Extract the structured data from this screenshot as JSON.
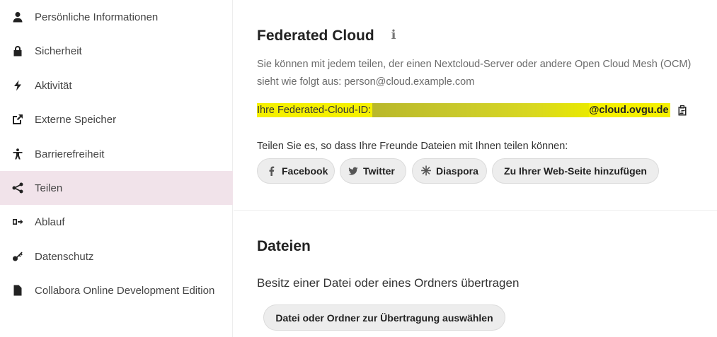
{
  "sidebar": {
    "items": [
      {
        "label": "Persönliche Informationen",
        "icon": "person-icon",
        "active": false
      },
      {
        "label": "Sicherheit",
        "icon": "lock-icon",
        "active": false
      },
      {
        "label": "Aktivität",
        "icon": "lightning-icon",
        "active": false
      },
      {
        "label": "Externe Speicher",
        "icon": "external-link-icon",
        "active": false
      },
      {
        "label": "Barrierefreiheit",
        "icon": "accessibility-icon",
        "active": false
      },
      {
        "label": "Teilen",
        "icon": "share-icon",
        "active": true
      },
      {
        "label": "Ablauf",
        "icon": "workflow-icon",
        "active": false
      },
      {
        "label": "Datenschutz",
        "icon": "key-icon",
        "active": false
      },
      {
        "label": "Collabora Online Development Edition",
        "icon": "document-icon",
        "active": false
      }
    ]
  },
  "federated": {
    "title": "Federated Cloud",
    "info_icon": "i",
    "desc_line1": "Sie können mit jedem teilen, der einen Nextcloud-Server oder andere Open Cloud Mesh (OCM)",
    "desc_line2": "sieht wie folgt aus: person@cloud.example.com",
    "cloud_id_label": "Ihre Federated-Cloud-ID:",
    "cloud_id_domain": "@cloud.ovgu.de",
    "share_text": "Teilen Sie es, so dass Ihre Freunde Dateien mit Ihnen teilen können:",
    "buttons": [
      {
        "label": "Facebook",
        "icon": "facebook-icon"
      },
      {
        "label": "Twitter",
        "icon": "twitter-icon"
      },
      {
        "label": "Diaspora",
        "icon": "diaspora-icon"
      },
      {
        "label": "Zu Ihrer Web-Seite hinzufügen"
      }
    ]
  },
  "files": {
    "title": "Dateien",
    "subheading": "Besitz einer Datei oder eines Ordners übertragen",
    "button_label": "Datei oder Ordner zur Übertragung auswählen"
  },
  "colors": {
    "active_nav_bg": "#f1e3ea",
    "highlight": "#f5f000",
    "button_bg": "#ededed"
  }
}
